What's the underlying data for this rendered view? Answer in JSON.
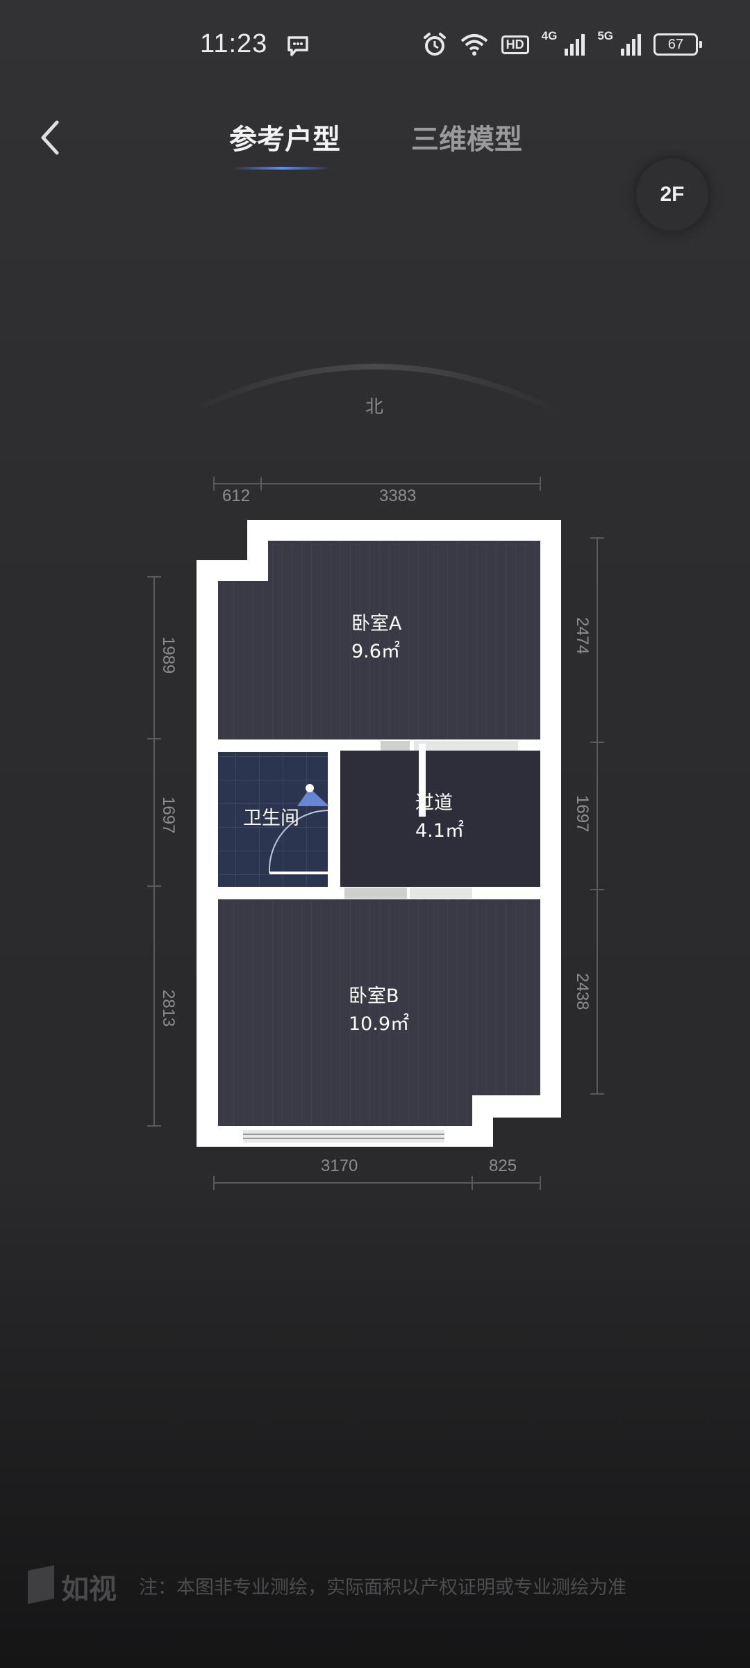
{
  "status_bar": {
    "time": "11:23",
    "battery": "67",
    "net_4g": "4G",
    "net_5g": "5G",
    "hd_badge": "HD"
  },
  "nav": {
    "tabs": [
      {
        "label": "参考户型",
        "active": true
      },
      {
        "label": "三维模型",
        "active": false
      }
    ],
    "floor": "2F"
  },
  "compass": {
    "label": "北"
  },
  "dimensions": {
    "top": [
      "612",
      "3383"
    ],
    "bottom": [
      "3170",
      "825"
    ],
    "left": [
      "1989",
      "1697",
      "2813"
    ],
    "right": [
      "2474",
      "1697",
      "2438"
    ]
  },
  "rooms": [
    {
      "name": "卧室A",
      "area": "9.6㎡"
    },
    {
      "name": "卫生间",
      "area": ""
    },
    {
      "name": "过道",
      "area": "4.1㎡"
    },
    {
      "name": "卧室B",
      "area": "10.9㎡"
    }
  ],
  "footer": {
    "brand": "如视",
    "disclaimer": "注：本图非专业测绘，实际面积以产权证明或专业测绘为准"
  },
  "colors": {
    "accent": "#5d8dff",
    "wall": "#ffffff",
    "room_floor": "#3a3a47",
    "bathroom_tile": "#2c3550"
  }
}
